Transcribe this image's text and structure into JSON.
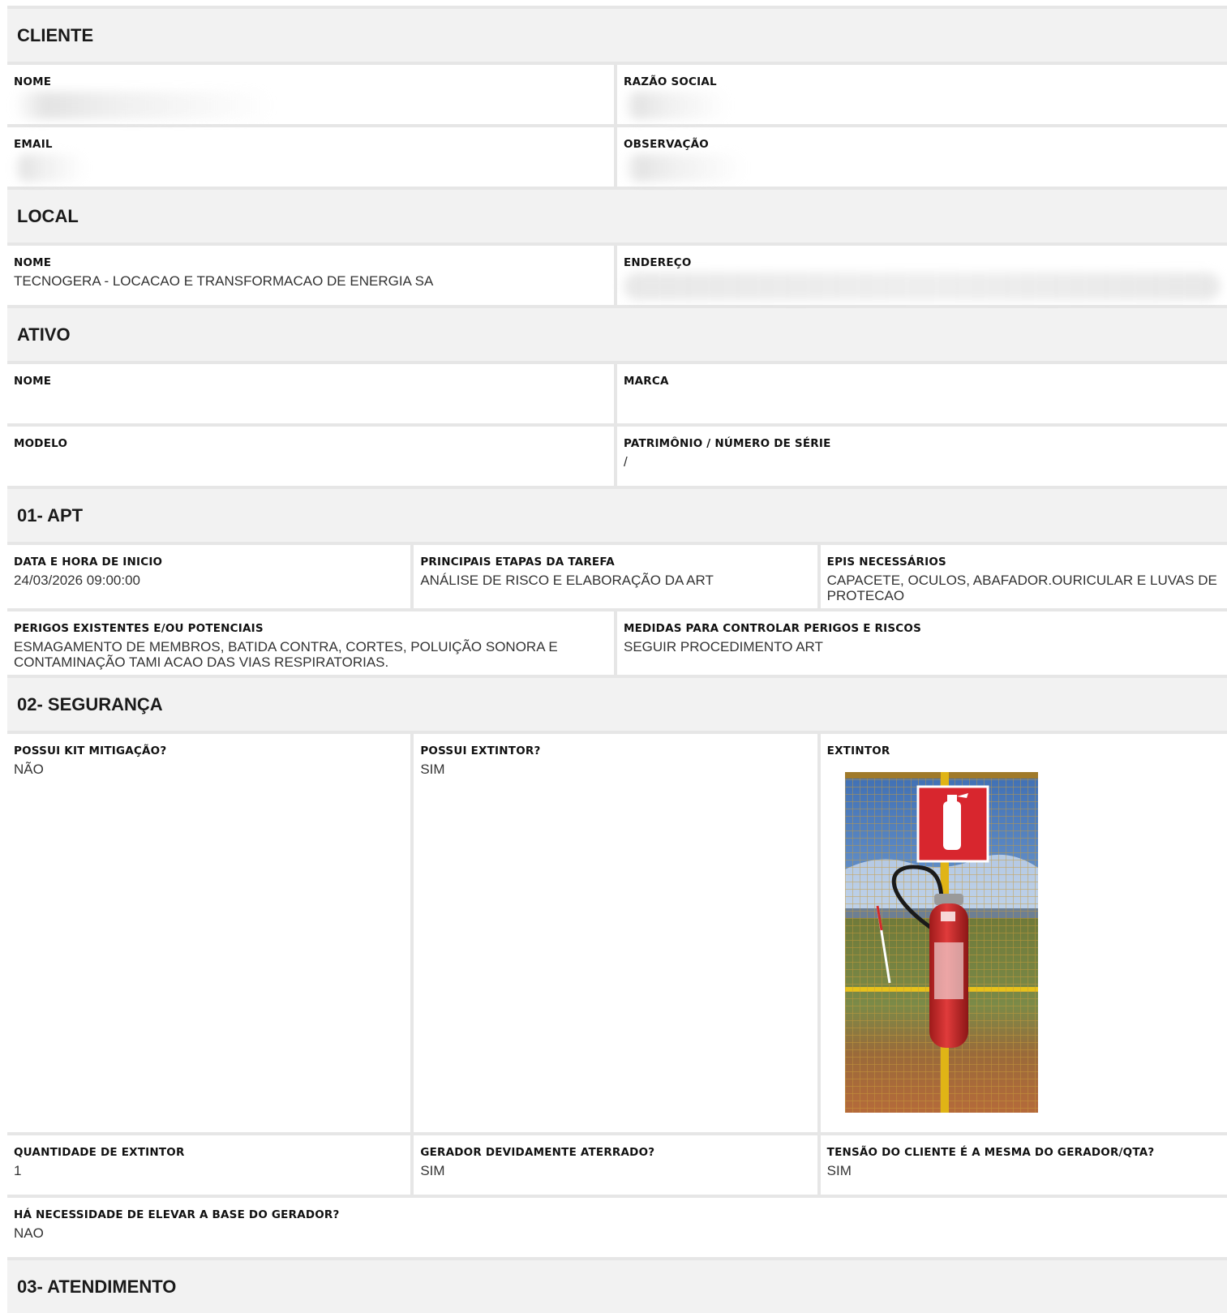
{
  "cliente": {
    "title": "CLIENTE",
    "nome_label": "NOME",
    "razao_label": "RAZÃO SOCIAL",
    "email_label": "EMAIL",
    "obs_label": "OBSERVAÇÃO"
  },
  "local": {
    "title": "LOCAL",
    "nome_label": "NOME",
    "nome_value": "TECNOGERA - LOCACAO E TRANSFORMACAO DE ENERGIA SA",
    "endereco_label": "ENDEREÇO"
  },
  "ativo": {
    "title": "ATIVO",
    "nome_label": "NOME",
    "marca_label": "MARCA",
    "modelo_label": "MODELO",
    "patrimonio_label": "PATRIMÔNIO / NÚMERO DE SÉRIE",
    "patrimonio_value": "/"
  },
  "apt": {
    "title": "01- APT",
    "data_label": "DATA E HORA DE INICIO",
    "data_value": "24/03/2026 09:00:00",
    "etapas_label": "PRINCIPAIS ETAPAS DA TAREFA",
    "etapas_value": "ANÁLISE DE RISCO E ELABORAÇÃO DA ART",
    "epis_label": "EPIS NECESSÁRIOS",
    "epis_value": "CAPACETE, OCULOS, ABAFADOR.OURICULAR E LUVAS DE PROTECAO",
    "perigos_label": "PERIGOS EXISTENTES E/OU POTENCIAIS",
    "perigos_value": "ESMAGAMENTO DE MEMBROS, BATIDA CONTRA, CORTES, POLUIÇÃO SONORA E CONTAMINAÇÃO TAMI ACAO DAS VIAS RESPIRATORIAS.",
    "medidas_label": "MEDIDAS PARA CONTROLAR PERIGOS E RISCOS",
    "medidas_value": "SEGUIR PROCEDIMENTO ART"
  },
  "seguranca": {
    "title": "02- SEGURANÇA",
    "kit_label": "POSSUI KIT MITIGAÇÃO?",
    "kit_value": "NÃO",
    "extintor_q_label": "POSSUI EXTINTOR?",
    "extintor_q_value": "SIM",
    "extintor_label": "EXTINTOR",
    "qtd_label": "QUANTIDADE DE EXTINTOR",
    "qtd_value": "1",
    "aterrado_label": "GERADOR DEVIDAMENTE ATERRADO?",
    "aterrado_value": "SIM",
    "tensao_label": "TENSÃO DO CLIENTE É A MESMA DO GERADOR/QTA?",
    "tensao_value": "SIM",
    "elevar_label": "HÁ NECESSIDADE DE ELEVAR A BASE DO GERADOR?",
    "elevar_value": "NAO"
  },
  "atendimento": {
    "title": "03- ATENDIMENTO"
  },
  "colors": {
    "section_bg": "#f2f2f2",
    "divider": "#e6e6e6",
    "extinguisher_red": "#d42a2a",
    "sign_red": "#d8262e",
    "frame_yellow": "#e8c21a"
  }
}
